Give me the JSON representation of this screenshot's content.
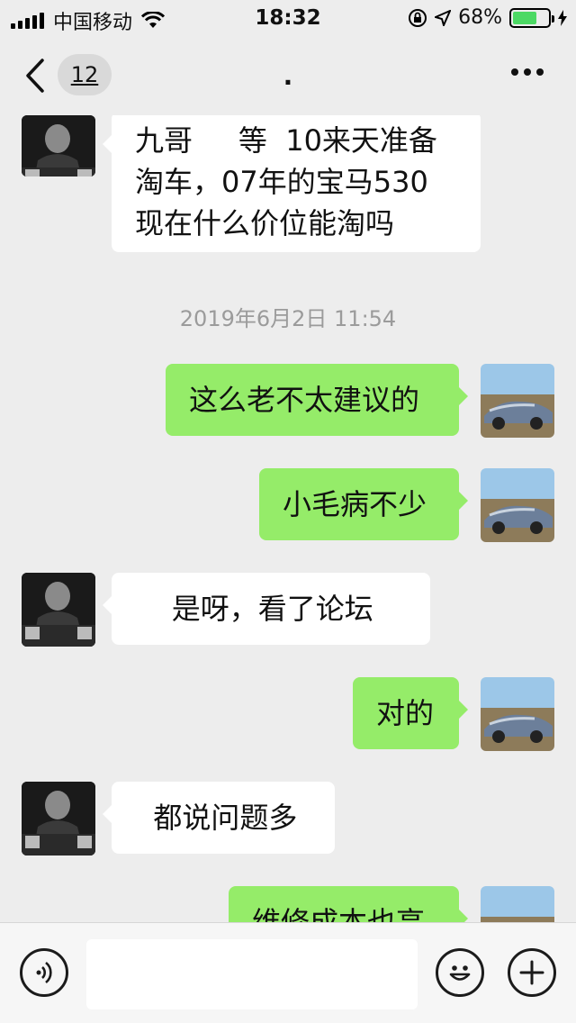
{
  "status_bar": {
    "carrier": "中国移动",
    "time": "18:32",
    "battery_text": "68%",
    "battery_level": 0.68,
    "icons": [
      "signal-icon",
      "wifi-icon",
      "orientation-lock-icon",
      "location-icon",
      "battery-icon",
      "charging-icon"
    ]
  },
  "nav": {
    "unread_count": "12",
    "title": ".",
    "icons": [
      "back-chevron-icon",
      "more-dots-icon"
    ]
  },
  "messages": [
    {
      "side": "left",
      "lines": [
        "九哥     等  10来天准备",
        "淘车，07年的宝马530",
        "现在什么价位能淘吗"
      ]
    },
    {
      "type": "timestamp",
      "text": "2019年6月2日 11:54"
    },
    {
      "side": "right",
      "text": "这么老不太建议的"
    },
    {
      "side": "right",
      "text": "小毛病不少"
    },
    {
      "side": "left",
      "text": "    是呀，看了论坛"
    },
    {
      "side": "right",
      "text": "对的"
    },
    {
      "side": "left",
      "text": "  都说问题多"
    },
    {
      "side": "right",
      "text": "维修成本也高"
    }
  ],
  "input_bar": {
    "value": "",
    "icons": [
      "voice-icon",
      "emoji-icon",
      "add-icon"
    ]
  },
  "colors": {
    "background": "#ededed",
    "my_bubble": "#95ec69",
    "their_bubble": "#ffffff",
    "battery": "#4cd964"
  }
}
